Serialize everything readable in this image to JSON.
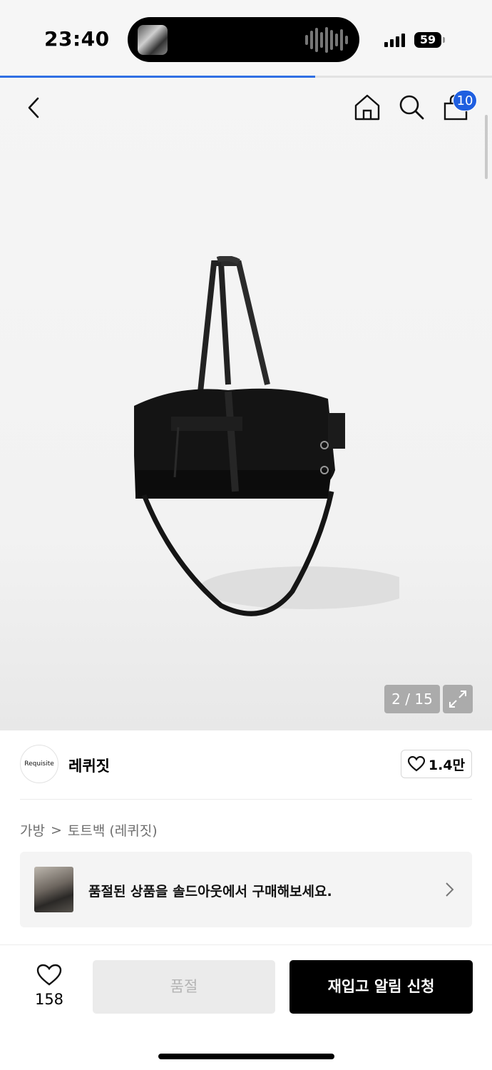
{
  "status_bar": {
    "time": "23:40",
    "battery": "59",
    "page_load_progress": 0.64
  },
  "header": {
    "icons": [
      "back-icon",
      "home-icon",
      "search-icon",
      "cart-icon"
    ],
    "cart_count": "10"
  },
  "gallery": {
    "counter": "2 / 15",
    "current": 2,
    "total": 15
  },
  "brand": {
    "logo_text": "Requisite",
    "name": "레퀴짓",
    "likes": "1.4만"
  },
  "breadcrumb": {
    "category": "가방",
    "separator": ">",
    "subcategory": "토트백 (레퀴짓)"
  },
  "soldout_banner": {
    "text": "품절된 상품을 솔드아웃에서 구매해보세요."
  },
  "bottom_bar": {
    "wish_count": "158",
    "soldout_label": "품절",
    "restock_label": "재입고 알림 신청"
  },
  "colors": {
    "accent": "#1f5fe0",
    "progress": "#2f6fe4",
    "primary_button": "#000000",
    "disabled_button": "#ebebeb"
  }
}
